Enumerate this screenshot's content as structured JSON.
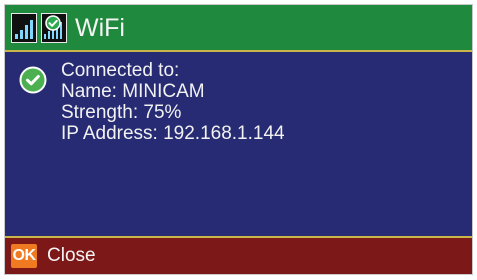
{
  "title_bar": {
    "title": "WiFi",
    "signal_icon": "signal-strength-icon",
    "wifi_status_icon": "wifi-check-icon"
  },
  "connection": {
    "status_icon": "check-circle-icon",
    "heading": "Connected to:",
    "name_line": "Name: MINICAM",
    "strength_line": "Strength: 75%",
    "ip_line": "IP Address: 192.168.1.144",
    "strength_percent": 75
  },
  "footer": {
    "ok_key_label": "OK",
    "close_label": "Close"
  },
  "colors": {
    "title_background": "#1f8a3d",
    "content_background": "#262b73",
    "footer_background": "#7d1818",
    "divider": "#c9b54a",
    "ok_key": "#f07a22",
    "check_green": "#4caf50",
    "text": "#f4f4f4"
  }
}
